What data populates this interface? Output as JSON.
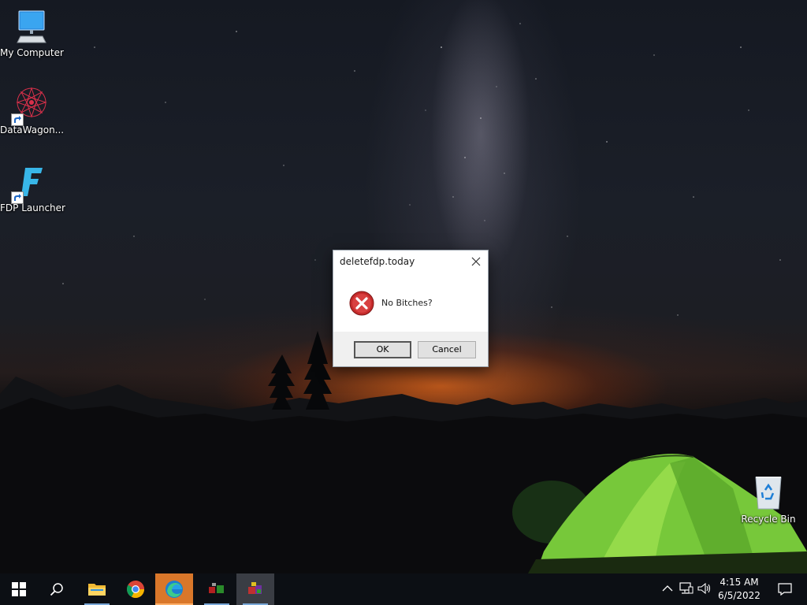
{
  "desktop": {
    "icons": [
      {
        "label": "My Computer"
      },
      {
        "label": "DataWagon..."
      },
      {
        "label": "FDP Launcher"
      },
      {
        "label": "Recycle Bin"
      }
    ]
  },
  "dialog": {
    "title": "deletefdp.today",
    "message": "No Bitches?",
    "icon": "error-icon",
    "buttons": {
      "ok": "OK",
      "cancel": "Cancel"
    }
  },
  "taskbar": {
    "apps": [
      {
        "name": "start",
        "icon": "windows-logo-icon"
      },
      {
        "name": "search",
        "icon": "search-icon"
      },
      {
        "name": "file-explorer",
        "icon": "folder-icon"
      },
      {
        "name": "chrome",
        "icon": "chrome-icon"
      },
      {
        "name": "edge",
        "icon": "edge-icon"
      },
      {
        "name": "app-1",
        "icon": "app-icon"
      },
      {
        "name": "app-2",
        "icon": "app-icon"
      }
    ],
    "clock": {
      "time": "4:15 AM",
      "date": "6/5/2022"
    }
  },
  "colors": {
    "accent": "#d9772a",
    "error": "#c42b2b",
    "taskbar": "#0c0f14"
  }
}
